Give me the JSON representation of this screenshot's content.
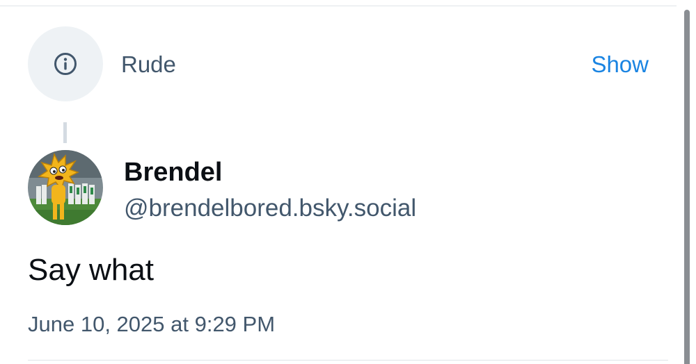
{
  "moderation": {
    "icon": "info-circle-icon",
    "label": "Rude",
    "action_label": "Show"
  },
  "post": {
    "author": {
      "display_name": "Brendel",
      "handle": "@brendelbored.bsky.social",
      "avatar_icon": "avatar-mascot"
    },
    "text": "Say what",
    "timestamp": "June 10, 2025 at 9:29 PM"
  },
  "colors": {
    "primary_text": "#0b0f14",
    "secondary_text": "#42576c",
    "link": "#1a84e2",
    "icon_background": "#eef2f5",
    "divider": "#dfe3e8"
  }
}
